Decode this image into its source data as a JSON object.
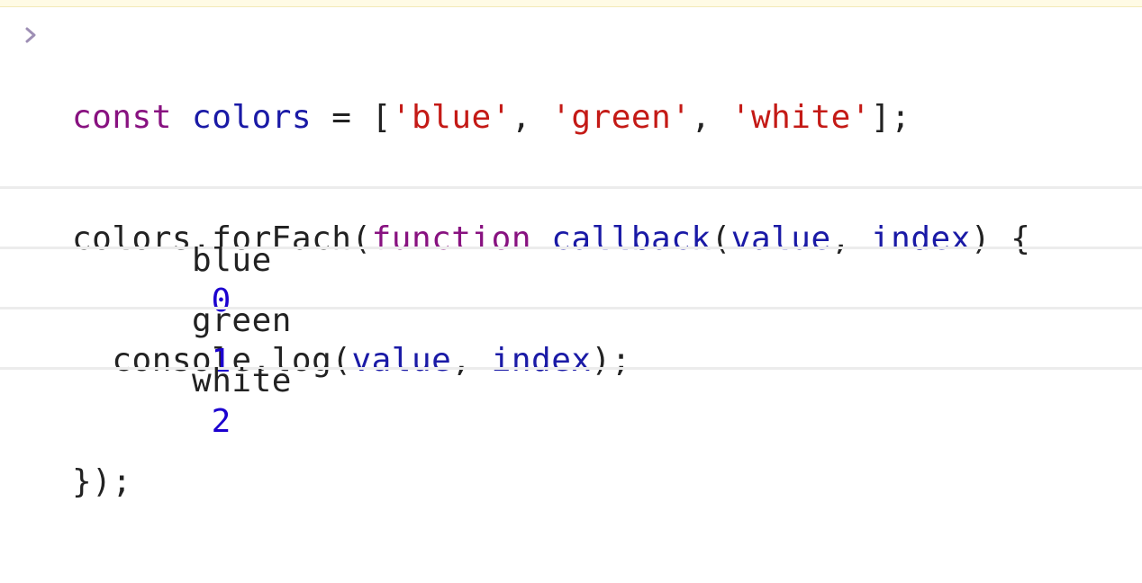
{
  "input": {
    "lines": [
      [
        {
          "t": "const ",
          "c": "kw"
        },
        {
          "t": "colors",
          "c": "var"
        },
        {
          "t": " = [",
          "c": "plain"
        },
        {
          "t": "'blue'",
          "c": "str"
        },
        {
          "t": ", ",
          "c": "plain"
        },
        {
          "t": "'green'",
          "c": "str"
        },
        {
          "t": ", ",
          "c": "plain"
        },
        {
          "t": "'white'",
          "c": "str"
        },
        {
          "t": "];",
          "c": "plain"
        }
      ],
      [
        {
          "t": "colors.forEach(",
          "c": "plain"
        },
        {
          "t": "function ",
          "c": "kw"
        },
        {
          "t": "callback",
          "c": "var"
        },
        {
          "t": "(",
          "c": "plain"
        },
        {
          "t": "value",
          "c": "var"
        },
        {
          "t": ", ",
          "c": "plain"
        },
        {
          "t": "index",
          "c": "var"
        },
        {
          "t": ") {",
          "c": "plain"
        }
      ],
      [
        {
          "t": "  console.log(",
          "c": "plain"
        },
        {
          "t": "value",
          "c": "var"
        },
        {
          "t": ", ",
          "c": "plain"
        },
        {
          "t": "index",
          "c": "var"
        },
        {
          "t": ");",
          "c": "plain"
        }
      ],
      [
        {
          "t": "});",
          "c": "plain"
        }
      ]
    ]
  },
  "outputs": [
    {
      "text": "blue",
      "num": "0"
    },
    {
      "text": "green",
      "num": "1"
    },
    {
      "text": "white",
      "num": "2"
    }
  ],
  "colors": {
    "keyword": "#881280",
    "variable": "#1a1aa6",
    "string": "#c41a16",
    "number": "#1c00cf",
    "prompt": "#9e8fb5"
  },
  "icons": {
    "prompt": "chevron-right-icon"
  }
}
